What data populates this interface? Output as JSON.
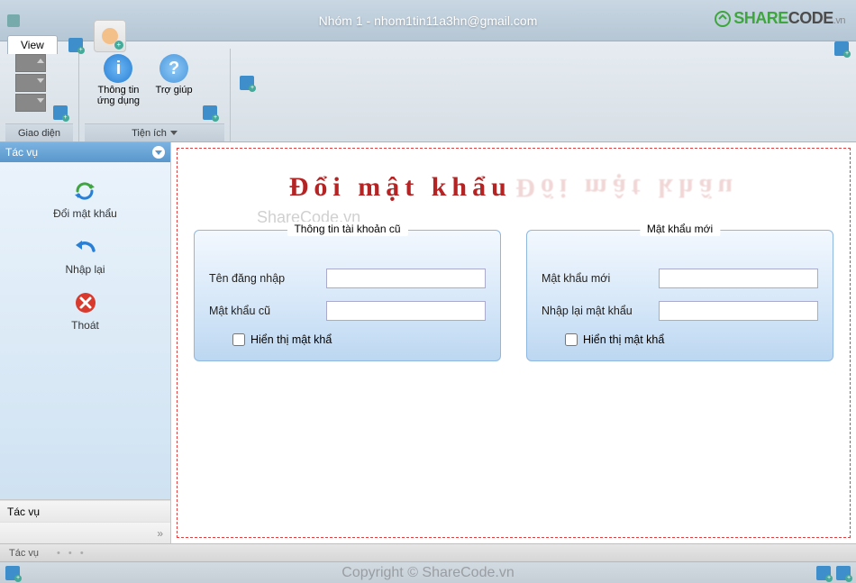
{
  "titlebar": {
    "title": "Nhóm 1 - nhom1tin11a3hn@gmail.com",
    "logo_text1": "SHARE",
    "logo_text2": "CODE",
    "logo_suffix": ".vn"
  },
  "tabs": {
    "view": "View"
  },
  "ribbon": {
    "group1_label": "Giao diện",
    "group2_label": "Tiện ích",
    "btn_info": "Thông tin\nứng dụng",
    "btn_help": "Trợ giúp"
  },
  "sidepanel": {
    "header": "Tác vụ",
    "items": [
      {
        "label": "Đổi mật khẩu"
      },
      {
        "label": "Nhập lại"
      },
      {
        "label": "Thoát"
      }
    ],
    "footer1": "Tác vụ",
    "expand": "»"
  },
  "main": {
    "watermark_left": "ShareCode.vn",
    "title": "Đổi  mật  khẩu",
    "group_old": {
      "legend": "Thông tin tài khoản cũ",
      "username_label": "Tên đăng nhập",
      "username_value": "",
      "password_label": "Mật khẩu cũ",
      "password_value": "",
      "showpw_label": "Hiển thị mật khẩ"
    },
    "group_new": {
      "legend": "Mật khẩu mới",
      "newpw_label": "Mật khẩu mới",
      "newpw_value": "",
      "confirm_label": "Nhập lại mật khẩu",
      "confirm_value": "",
      "showpw_label": "Hiển thị mật khẩ"
    }
  },
  "bottom": {
    "label": "Tác vụ",
    "copyright": "Copyright © ShareCode.vn"
  }
}
